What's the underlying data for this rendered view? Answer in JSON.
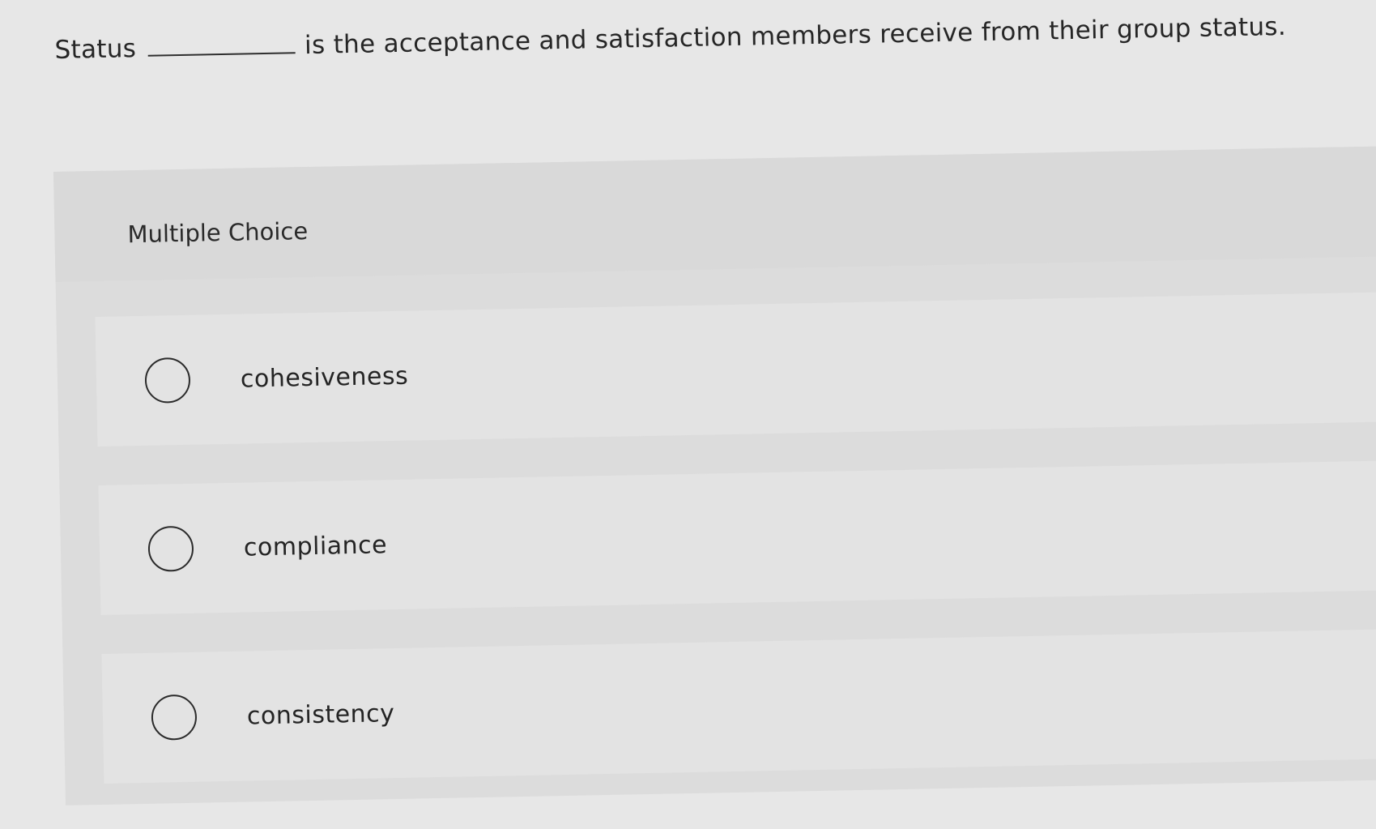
{
  "question": {
    "prefix": "Status",
    "suffix": "is the acceptance and satisfaction members receive from their group status."
  },
  "section_label": "Multiple Choice",
  "options": [
    {
      "label": "cohesiveness",
      "selected": false
    },
    {
      "label": "compliance",
      "selected": false
    },
    {
      "label": "consistency",
      "selected": false
    }
  ]
}
